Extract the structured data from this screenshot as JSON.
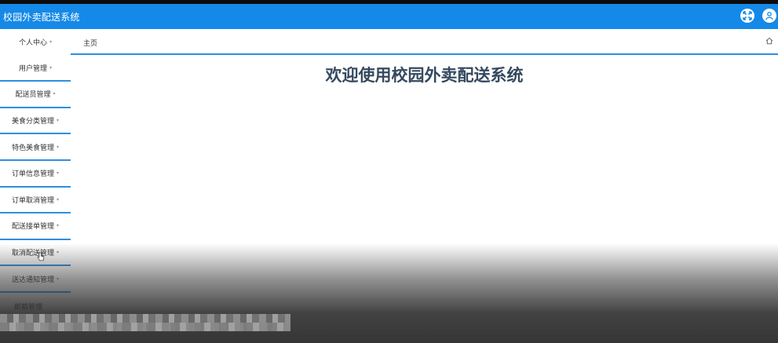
{
  "app": {
    "title": "校园外卖配送系统"
  },
  "header": {
    "icons": [
      "fullscreen-icon",
      "user-icon"
    ],
    "accent": "#1589e8"
  },
  "sidebar": {
    "items": [
      {
        "label": "个人中心"
      },
      {
        "label": "用户管理"
      },
      {
        "label": "配送员管理"
      },
      {
        "label": "美食分类管理"
      },
      {
        "label": "特色美食管理"
      },
      {
        "label": "订单信息管理"
      },
      {
        "label": "订单取消管理"
      },
      {
        "label": "配送接单管理"
      },
      {
        "label": "取消配送管理"
      },
      {
        "label": "送达通知管理"
      }
    ],
    "caret": "▾",
    "partial_item": "邮箱管理"
  },
  "breadcrumb": {
    "home": "主页"
  },
  "main": {
    "welcome": "欢迎使用校园外卖配送系统"
  },
  "colors": {
    "border": "#2f8fe0",
    "heading": "#34495e"
  }
}
